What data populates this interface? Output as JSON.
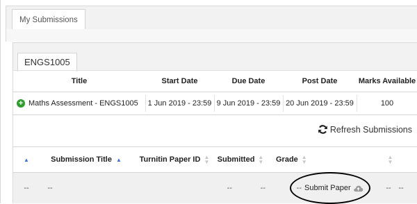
{
  "top_tabs": [
    "My Submissions"
  ],
  "course_tabs": [
    "ENGS1005"
  ],
  "assignment_table": {
    "headers": [
      "Title",
      "Start Date",
      "Due Date",
      "Post Date",
      "Marks Available"
    ],
    "row": {
      "title": "Maths Assessment - ENGS1005",
      "start_date": "1 Jun 2019 - 23:59",
      "due_date": "9 Jun 2019 - 23:59",
      "post_date": "20 Jun 2019 - 23:59",
      "marks_available": "100"
    }
  },
  "refresh_label": "Refresh Submissions",
  "submission_table": {
    "headers": [
      "Submission Title",
      "Turnitin Paper ID",
      "Submitted",
      "Grade"
    ],
    "row": {
      "col0": "--",
      "col1": "--",
      "paper_id": "--",
      "submitted": "--",
      "grade": "--",
      "submit_label": "Submit Paper",
      "col7": "--",
      "col8": "--"
    }
  },
  "colors": {
    "accent_green": "#2e9d2e",
    "sort_active": "#3d6fd6"
  }
}
